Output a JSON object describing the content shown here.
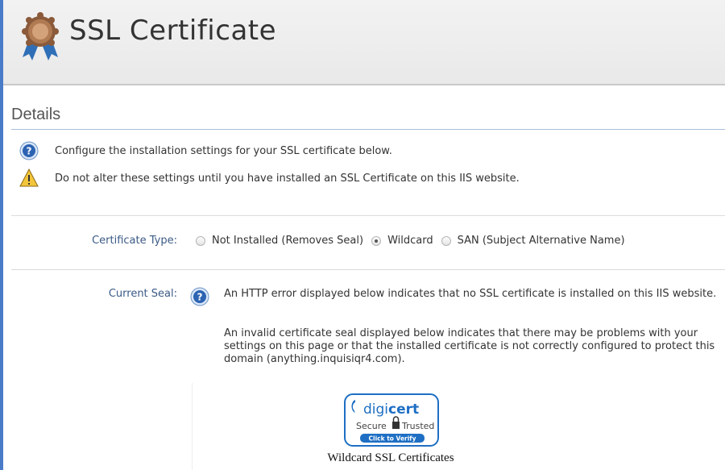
{
  "header": {
    "title": "SSL Certificate",
    "icon": "award-ribbon-icon"
  },
  "details": {
    "title": "Details",
    "messages": [
      {
        "icon": "help-icon",
        "text": "Configure the installation settings for your SSL certificate below."
      },
      {
        "icon": "warning-icon",
        "text": "Do not alter these settings until you have installed an SSL Certificate on this IIS website."
      }
    ]
  },
  "certificate_type": {
    "label": "Certificate Type:",
    "options": [
      {
        "label": "Not Installed (Removes Seal)",
        "selected": false
      },
      {
        "label": "Wildcard",
        "selected": true
      },
      {
        "label": "SAN (Subject Alternative Name)",
        "selected": false
      }
    ]
  },
  "current_seal": {
    "label": "Current Seal:",
    "info_1": "An HTTP error displayed below indicates that no SSL certificate is installed on this IIS website.",
    "info_2": "An invalid certificate seal displayed below indicates that there may be problems with your settings on this page or that the installed certificate is not correctly configured to protect this domain (anything.inquisiqr4.com).",
    "seal": {
      "brand_prefix": "digi",
      "brand_suffix": "cert",
      "secure_text": "Secure",
      "trusted_text": "Trusted",
      "verify_text": "Click to Verify",
      "caption": "Wildcard SSL Certificates"
    }
  },
  "colors": {
    "accent_bar": "#4a7bc8",
    "label": "#3b5a86",
    "digicert_blue": "#1e6fc4"
  }
}
